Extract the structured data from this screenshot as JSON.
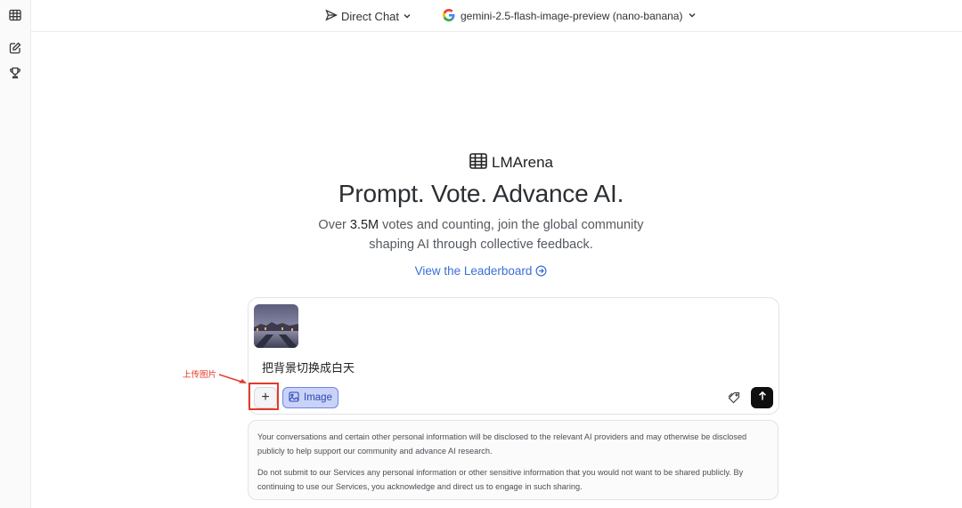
{
  "sidebar": {
    "icons": [
      "table-icon",
      "edit-icon",
      "trophy-icon"
    ]
  },
  "header": {
    "mode_label": "Direct Chat",
    "model_label": "gemini-2.5-flash-image-preview (nano-banana)"
  },
  "hero": {
    "brand": "LMArena",
    "title": "Prompt. Vote. Advance AI.",
    "subtitle_prefix": "Over ",
    "subtitle_highlight": "3.5M",
    "subtitle_line1_rest": " votes and counting, join the global community",
    "subtitle_line2": "shaping AI through collective feedback.",
    "leaderboard_link": "View the Leaderboard"
  },
  "composer": {
    "prompt": "把背景切换成白天",
    "plus_label": "+",
    "image_chip_label": "Image"
  },
  "annotation": {
    "label": "上传图片",
    "color": "#e23b2a"
  },
  "disclaimer": {
    "p1": "Your conversations and certain other personal information will be disclosed to the relevant AI providers and may otherwise be disclosed publicly to help support our community and advance AI research.",
    "p2": "Do not submit to our Services any personal information or other sensitive information that you would not want to be shared publicly. By continuing to use our Services, you acknowledge and direct us to engage in such sharing."
  },
  "colors": {
    "accent_link": "#3a6fd8",
    "image_chip_bg": "#c9d3f8",
    "send_button": "#0f0f0f"
  }
}
